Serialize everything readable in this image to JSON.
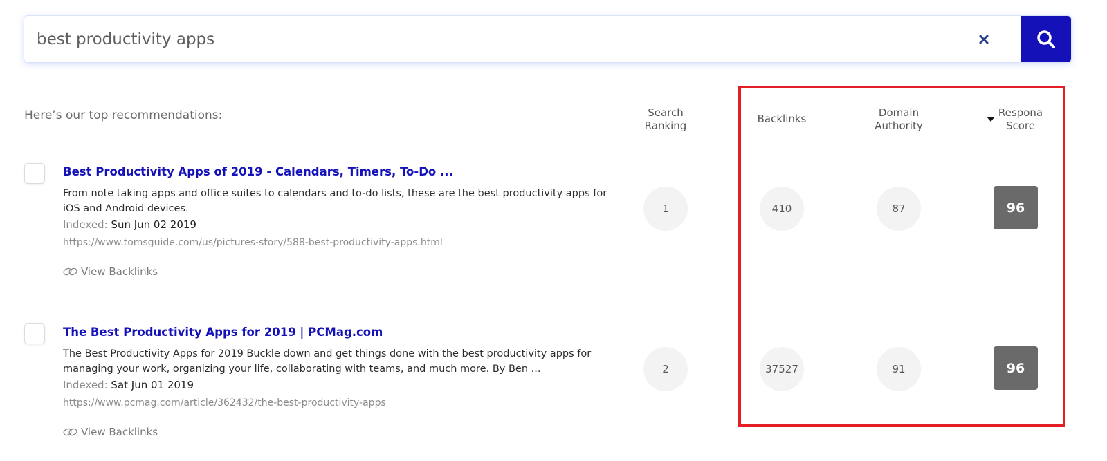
{
  "search": {
    "query": "best productivity apps",
    "clear_icon": "close-icon",
    "search_icon": "search-icon"
  },
  "intro": "Here’s our top recommendations:",
  "columns": {
    "search_ranking": [
      "Search",
      "Ranking"
    ],
    "backlinks": "Backlinks",
    "domain_authority": [
      "Domain",
      "Authority"
    ],
    "respona_score": [
      "Respona",
      "Score"
    ]
  },
  "results": [
    {
      "title": "Best Productivity Apps of 2019 - Calendars, Timers, To-Do ...",
      "snippet": "From note taking apps and office suites to calendars and to-do lists, these are the best productivity apps for iOS and Android devices.",
      "indexed_label": "Indexed:",
      "indexed_date": "Sun Jun 02 2019",
      "url": "https://www.tomsguide.com/us/pictures-story/588-best-productivity-apps.html",
      "view_backlinks": "View Backlinks",
      "search_ranking": "1",
      "backlinks": "410",
      "domain_authority": "87",
      "respona_score": "96"
    },
    {
      "title": "The Best Productivity Apps for 2019 | PCMag.com",
      "snippet": "The Best Productivity Apps for 2019 Buckle down and get things done with the best productivity apps for managing your work, organizing your life, collaborating with teams, and much more. By Ben ...",
      "indexed_label": "Indexed:",
      "indexed_date": "Sat Jun 01 2019",
      "url": "https://www.pcmag.com/article/362432/the-best-productivity-apps",
      "view_backlinks": "View Backlinks",
      "search_ranking": "2",
      "backlinks": "37527",
      "domain_authority": "91",
      "respona_score": "96"
    }
  ],
  "colors": {
    "accent": "#1411b8",
    "score_bg": "#6a6a6a",
    "highlight": "#e41e26"
  }
}
